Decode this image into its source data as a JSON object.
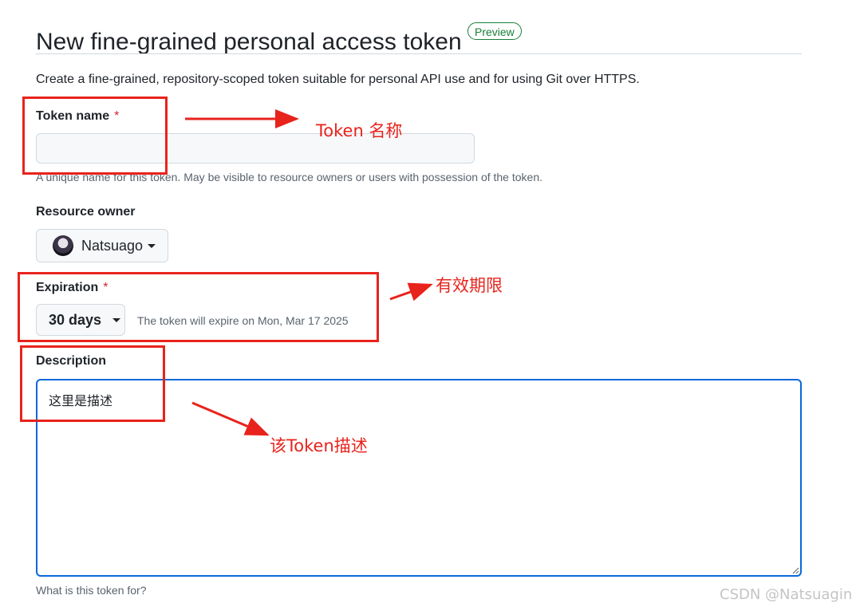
{
  "page": {
    "title": "New fine-grained personal access token",
    "badge": "Preview",
    "intro": "Create a fine-grained, repository-scoped token suitable for personal API use and for using Git over HTTPS."
  },
  "token_name": {
    "label": "Token name",
    "required_mark": "*",
    "value": "",
    "help": "A unique name for this token. May be visible to resource owners or users with possession of the token."
  },
  "resource_owner": {
    "label": "Resource owner",
    "selected": "Natsuago"
  },
  "expiration": {
    "label": "Expiration",
    "required_mark": "*",
    "selected": "30 days",
    "note": "The token will expire on Mon, Mar 17 2025"
  },
  "description": {
    "label": "Description",
    "value": "这里是描述",
    "help": "What is this token for?"
  },
  "annotations": {
    "token_name": "Token 名称",
    "expiration": "有效期限",
    "description": "该Token描述",
    "color": "#e8231c"
  },
  "watermark": "CSDN @Natsuagin",
  "colors": {
    "accent_focus": "#0969da",
    "badge_green": "#1a7f37",
    "required_red": "#d1242f"
  }
}
